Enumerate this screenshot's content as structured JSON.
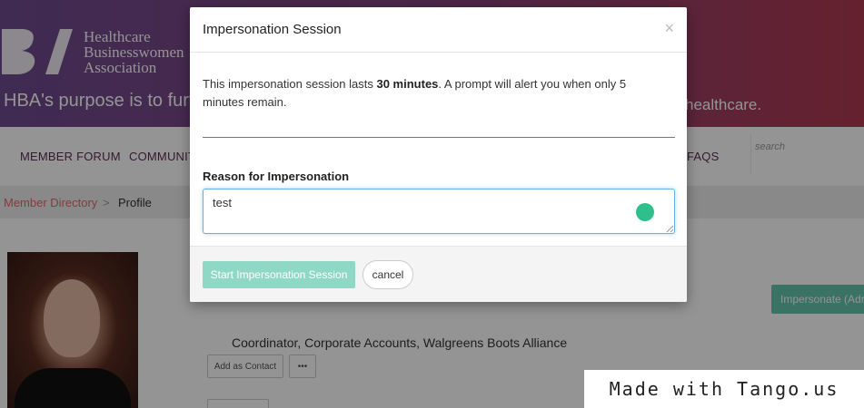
{
  "site": {
    "logo_lines": [
      "Healthcare",
      "Businesswomen",
      "Association"
    ],
    "tagline_left": "HBA's purpose is to furt",
    "tagline_right": "healthcare.",
    "colors": {
      "hero_start": "#6e4a8f",
      "hero_end": "#b03a50",
      "nav_text": "#5c2d55",
      "accent": "#64c5ad"
    }
  },
  "nav": {
    "items": [
      "MEMBER FORUM",
      "COMMUNITI",
      "FAQS"
    ],
    "search_placeholder": "search"
  },
  "breadcrumb": {
    "parent": "Member Directory",
    "separator": ">",
    "current": "Profile"
  },
  "profile": {
    "job_title": "Coordinator, Corporate Accounts, Walgreens Boots Alliance",
    "add_contact_label": "Add as Contact",
    "more_label": "•••",
    "impersonate_label": "Impersonate (Adr"
  },
  "modal": {
    "title": "Impersonation Session",
    "close_glyph": "×",
    "desc_before": "This impersonation session lasts ",
    "desc_bold": "30 minutes",
    "desc_after": ". A prompt will alert you when only 5 minutes remain.",
    "reason_label": "Reason for Impersonation",
    "reason_value": "test",
    "start_label": "Start Impersonation Session",
    "cancel_label": "cancel"
  },
  "watermark": "Made with Tango.us"
}
